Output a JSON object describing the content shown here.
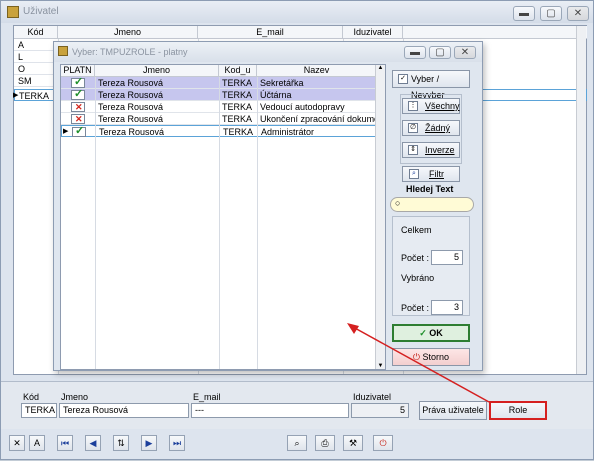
{
  "window": {
    "title": "Uživatel",
    "controls": [
      "minimize",
      "maximize",
      "close"
    ]
  },
  "main_grid": {
    "columns": [
      "Kód",
      "Jmeno",
      "E_mail",
      "Iduzivatel"
    ],
    "rows": [
      {
        "kod": "A"
      },
      {
        "kod": "L"
      },
      {
        "kod": "O"
      },
      {
        "kod": "SM"
      },
      {
        "kod": "TERKA"
      }
    ]
  },
  "dialog": {
    "title": "Vyber: TMPUZROLE - platny",
    "columns": [
      "PLATN",
      "Jmeno",
      "Kod_u",
      "Nazev"
    ],
    "rows": [
      {
        "platny": true,
        "jmeno": "Tereza Rousová",
        "kod_u": "TERKA",
        "nazev": "Sekretářka"
      },
      {
        "platny": true,
        "jmeno": "Tereza Rousová",
        "kod_u": "TERKA",
        "nazev": "Účtárna"
      },
      {
        "platny": false,
        "jmeno": "Tereza Rousová",
        "kod_u": "TERKA",
        "nazev": "Vedoucí autodopravy"
      },
      {
        "platny": false,
        "jmeno": "Tereza Rousová",
        "kod_u": "TERKA",
        "nazev": "Ukončení zpracování dokument"
      },
      {
        "platny": true,
        "jmeno": "Tereza Rousová",
        "kod_u": "TERKA",
        "nazev": "Administrátor"
      }
    ],
    "buttons": {
      "vyber": "Vyber / Nevyber",
      "vsechny": "Všechny",
      "zadny": "Žádný",
      "inverze": "Inverze",
      "filtr": "Filtr",
      "ok": "OK",
      "storno": "Storno"
    },
    "search_label": "Hledej Text",
    "search_value": "",
    "stats": {
      "celkem_label": "Celkem",
      "pocet_label": "Počet :",
      "celkem_pocet": "5",
      "vybrano_label": "Vybráno",
      "vybrano_pocet": "3"
    }
  },
  "detail": {
    "labels": {
      "kod": "Kód",
      "jmeno": "Jmeno",
      "email": "E_mail",
      "iduzivatel": "Iduzivatel"
    },
    "values": {
      "kod": "TERKA",
      "jmeno": "Tereza Rousová",
      "email": "---",
      "iduzivatel": "5"
    },
    "buttons": {
      "prava": "Práva uživatele",
      "role": "Role"
    }
  },
  "colors": {
    "selected_row": "#c6c6ee",
    "annotation_red": "#d52020",
    "ok_border": "#2e7d32"
  }
}
